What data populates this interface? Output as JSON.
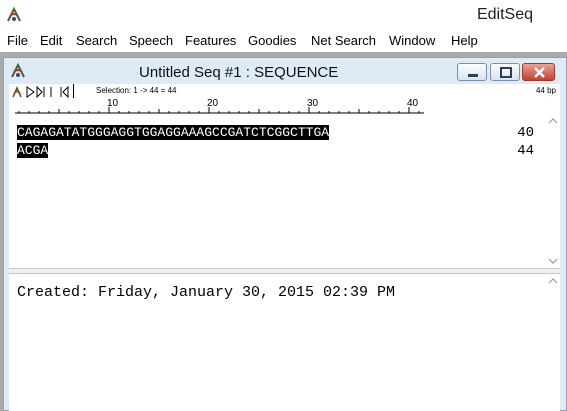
{
  "app": {
    "title": "EditSeq"
  },
  "menu": [
    "File",
    "Edit",
    "Search",
    "Speech",
    "Features",
    "Goodies",
    "Net Search",
    "Window",
    "Help"
  ],
  "document": {
    "title": "Untitled Seq #1 : SEQUENCE"
  },
  "toolbar": {
    "selection": "Selection: 1 -> 44 = 44",
    "length": "44 bp"
  },
  "ruler": {
    "ticks": [
      "10",
      "20",
      "30",
      "40"
    ]
  },
  "sequence": {
    "lines": [
      {
        "text": "CAGAGATATGGGAGGTGGAGGAAAGCCGATCTCGGCTTGA",
        "end": "40"
      },
      {
        "text": "ACGA",
        "end": "44"
      }
    ]
  },
  "comment": {
    "text": "Created: Friday, January 30, 2015 02:39 PM"
  },
  "colors": {
    "selection_bg": "#000000",
    "close_button": "#c7402e",
    "doc_frame": "#dfeaf7",
    "mdi_bg": "#ababab"
  }
}
